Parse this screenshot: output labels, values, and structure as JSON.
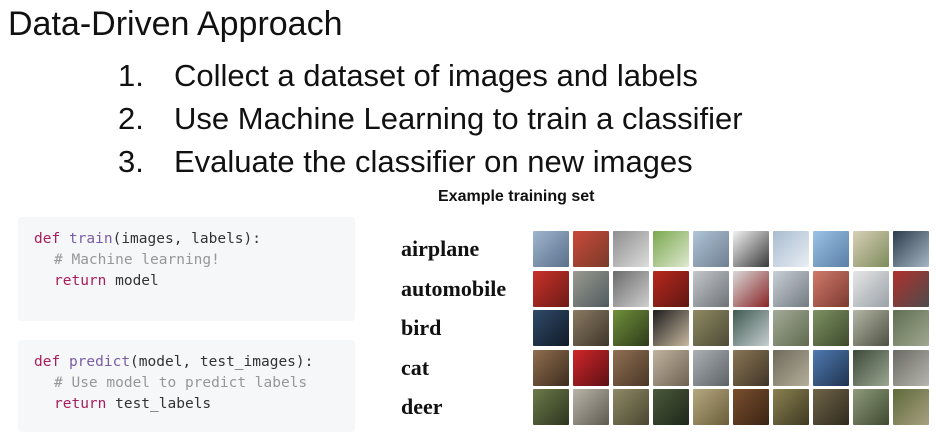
{
  "title": "Data-Driven Approach",
  "steps": [
    {
      "num": "1.",
      "text": "Collect a dataset of images and labels"
    },
    {
      "num": "2.",
      "text": "Use Machine Learning to train a classifier"
    },
    {
      "num": "3.",
      "text": "Evaluate the classifier on new images"
    }
  ],
  "training_set_caption": "Example training set",
  "code": {
    "train": {
      "def": "def",
      "name": "train",
      "sig": "(images, labels):",
      "comment": "# Machine learning!",
      "ret": "return",
      "ret_value": " model"
    },
    "predict": {
      "def": "def",
      "name": "predict",
      "sig": "(model, test_images):",
      "comment": "# Use model to predict labels",
      "ret": "return",
      "ret_value": " test_labels"
    }
  },
  "classes": [
    "airplane",
    "automobile",
    "bird",
    "cat",
    "deer"
  ],
  "thumbnails": [
    {
      "row": "airplane",
      "colors": [
        [
          "#9fb6d0",
          "#5a6f8a"
        ],
        [
          "#c94a3a",
          "#7a3a2a"
        ],
        [
          "#8f8f8f",
          "#dcdcdc"
        ],
        [
          "#7aa84f",
          "#dfe8d0"
        ],
        [
          "#b0c4d8",
          "#6e7f90"
        ],
        [
          "#f2f2f2",
          "#3a3a3a"
        ],
        [
          "#a8bcd0",
          "#e9eef4"
        ],
        [
          "#9cc2e6",
          "#5a7ea6"
        ],
        [
          "#d8d0b8",
          "#7d8b5a"
        ],
        [
          "#2b3c4c",
          "#a7b6c4"
        ]
      ]
    },
    {
      "row": "automobile",
      "colors": [
        [
          "#c8322a",
          "#6e1a16"
        ],
        [
          "#9b9b8f",
          "#4f5a5f"
        ],
        [
          "#6b6b6b",
          "#cfcfcf"
        ],
        [
          "#b8281e",
          "#5e1712"
        ],
        [
          "#c3c7cc",
          "#6e7378"
        ],
        [
          "#d9d9d9",
          "#8a2424"
        ],
        [
          "#c9cfd6",
          "#727a82"
        ],
        [
          "#d07a6a",
          "#7c3a30"
        ],
        [
          "#e6e6e6",
          "#9aa2a8"
        ],
        [
          "#b0302c",
          "#4c4c4c"
        ]
      ]
    },
    {
      "row": "bird",
      "colors": [
        [
          "#2f4a6a",
          "#111b26"
        ],
        [
          "#8a7a62",
          "#3e352a"
        ],
        [
          "#6f8f3a",
          "#2e3b1a"
        ],
        [
          "#1d1d1d",
          "#c8b8a0"
        ],
        [
          "#8f8a62",
          "#4c4a36"
        ],
        [
          "#3e5a52",
          "#c7ced0"
        ],
        [
          "#a3aa98",
          "#5f6a4e"
        ],
        [
          "#7e9262",
          "#3d4a2c"
        ],
        [
          "#b3b6a4",
          "#4e5142"
        ],
        [
          "#5f6e52",
          "#a0a88e"
        ]
      ]
    },
    {
      "row": "cat",
      "colors": [
        [
          "#8f6e4e",
          "#3e2c1e"
        ],
        [
          "#d0262a",
          "#5c1013"
        ],
        [
          "#8f6f52",
          "#4a3626"
        ],
        [
          "#c0b3a0",
          "#6e6250"
        ],
        [
          "#aab0b4",
          "#5c6266"
        ],
        [
          "#8a7656",
          "#3f3425"
        ],
        [
          "#6e6a5a",
          "#b4ae9a"
        ],
        [
          "#4f7ab0",
          "#1f3350"
        ],
        [
          "#3d4a3a",
          "#9aa690"
        ],
        [
          "#6a6a64",
          "#b6b6ae"
        ]
      ]
    },
    {
      "row": "deer",
      "colors": [
        [
          "#6b7a4a",
          "#2e351f"
        ],
        [
          "#b8b4a8",
          "#5e5a50"
        ],
        [
          "#8e8a66",
          "#4a4630"
        ],
        [
          "#4a5a3a",
          "#1e261a"
        ],
        [
          "#b4a880",
          "#6b5e3a"
        ],
        [
          "#7a4e2e",
          "#3a2414"
        ],
        [
          "#8a8050",
          "#3f3a22"
        ],
        [
          "#6f6448",
          "#2f2a1d"
        ],
        [
          "#8e9a7a",
          "#3f4a30"
        ],
        [
          "#5e6a3a",
          "#a7a080"
        ]
      ]
    }
  ]
}
